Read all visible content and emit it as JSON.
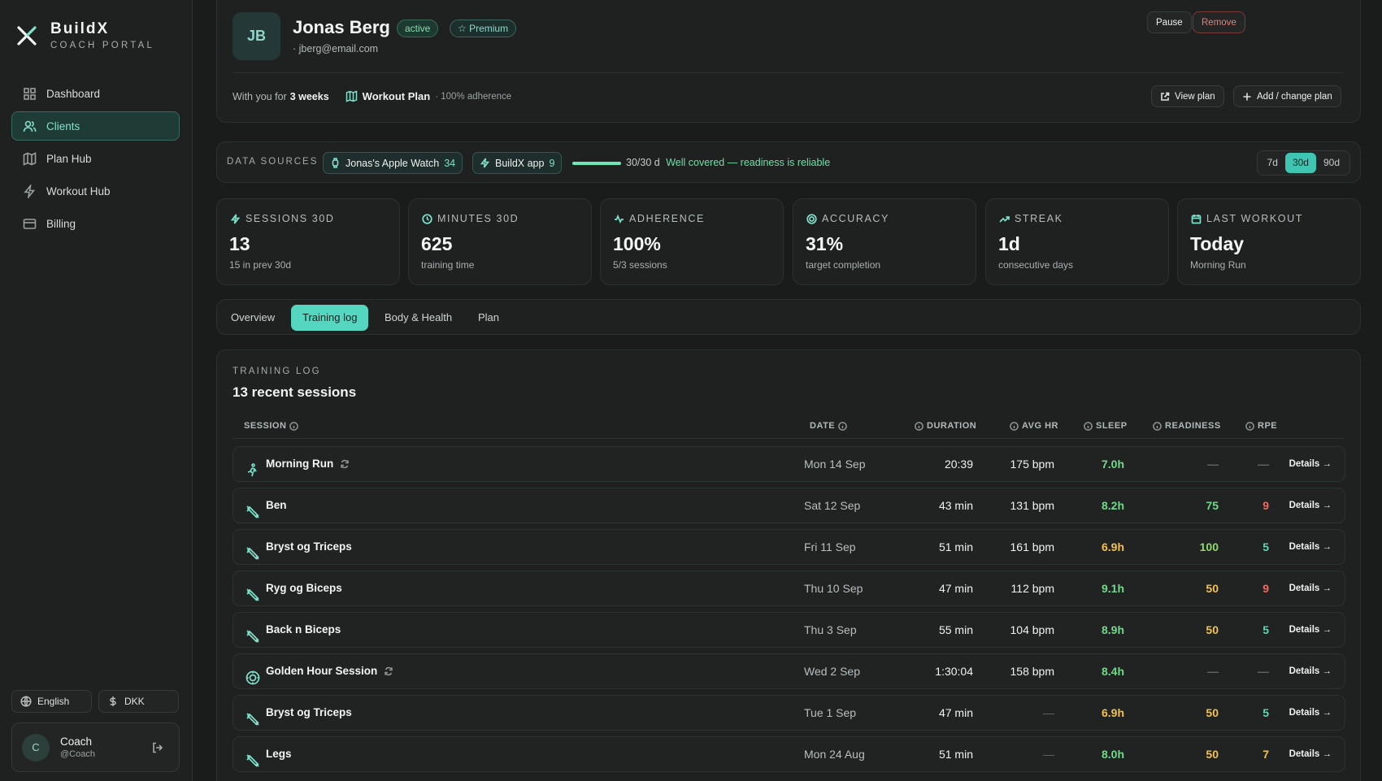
{
  "brand": {
    "name": "BuildX",
    "subtitle": "COACH PORTAL"
  },
  "nav": [
    {
      "label": "Dashboard",
      "icon": "grid-icon",
      "active": false
    },
    {
      "label": "Clients",
      "icon": "users-icon",
      "active": true
    },
    {
      "label": "Plan Hub",
      "icon": "map-icon",
      "active": false
    },
    {
      "label": "Workout Hub",
      "icon": "bolt-icon",
      "active": false
    },
    {
      "label": "Billing",
      "icon": "card-icon",
      "active": false
    }
  ],
  "settings": {
    "language": "English",
    "currency": "DKK"
  },
  "user": {
    "initial": "C",
    "name": "Coach",
    "handle": "@Coach"
  },
  "client": {
    "initials": "JB",
    "name": "Jonas Berg",
    "status": "active",
    "tier": "Premium",
    "email": "· jberg@email.com",
    "tenure_prefix": "With you for",
    "tenure_value": "3 weeks",
    "plan": "Workout Plan",
    "plan_adherence": "· 100% adherence",
    "actions": {
      "pause": "Pause",
      "remove": "Remove",
      "view_plan": "View plan",
      "change_plan": "Add / change plan"
    }
  },
  "sources": {
    "label": "DATA SOURCES",
    "items": [
      {
        "name": "Jonas's Apple Watch",
        "count": "34"
      },
      {
        "name": "BuildX app",
        "count": "9"
      }
    ],
    "coverage_fraction": 1.0,
    "coverage": "30/30 d",
    "coverage_status": "Well covered — readiness is reliable",
    "ranges": [
      "7d",
      "30d",
      "90d"
    ],
    "active_range": "30d"
  },
  "stats": [
    {
      "label": "SESSIONS 30D",
      "value": "13",
      "sub": "15 in prev 30d",
      "icon": "bolt-icon"
    },
    {
      "label": "MINUTES 30D",
      "value": "625",
      "sub": "training time",
      "icon": "clock-icon"
    },
    {
      "label": "ADHERENCE",
      "value": "100%",
      "sub": "5/3 sessions",
      "icon": "pulse-icon"
    },
    {
      "label": "ACCURACY",
      "value": "31%",
      "sub": "target completion",
      "icon": "target-icon"
    },
    {
      "label": "STREAK",
      "value": "1d",
      "sub": "consecutive days",
      "icon": "trend-icon"
    },
    {
      "label": "LAST WORKOUT",
      "value": "Today",
      "sub": "Morning Run",
      "icon": "calendar-icon"
    }
  ],
  "tabs": [
    "Overview",
    "Training log",
    "Body & Health",
    "Plan"
  ],
  "active_tab": "Training log",
  "log": {
    "label": "TRAINING LOG",
    "title": "13 recent sessions",
    "columns": {
      "session": "SESSION",
      "date": "DATE",
      "duration": "DURATION",
      "avg_hr": "AVG HR",
      "sleep": "SLEEP",
      "readiness": "READINESS",
      "rpe": "RPE"
    },
    "details_label": "Details →",
    "colors": {
      "green": "#73d98a",
      "yellow": "#f2c14e",
      "red": "#ef6a5f",
      "teal": "#5fd6b4",
      "lime": "#8fd96a"
    },
    "rows": [
      {
        "icon": "run-icon",
        "name": "Morning Run",
        "synced": true,
        "date": "Mon 14 Sep",
        "duration": "20:39",
        "avg_hr": "175 bpm",
        "sleep": "7.0h",
        "sleep_color": "#73d98a",
        "readiness": "—",
        "readiness_color": "#5f6464",
        "rpe": "—",
        "rpe_color": "#5f6464"
      },
      {
        "icon": "dumbbell-icon",
        "name": "Ben",
        "synced": false,
        "date": "Sat 12 Sep",
        "duration": "43 min",
        "avg_hr": "131 bpm",
        "sleep": "8.2h",
        "sleep_color": "#73d98a",
        "readiness": "75",
        "readiness_color": "#73d98a",
        "rpe": "9",
        "rpe_color": "#ef6a5f"
      },
      {
        "icon": "dumbbell-icon",
        "name": "Bryst og Triceps",
        "synced": false,
        "date": "Fri 11 Sep",
        "duration": "51 min",
        "avg_hr": "161 bpm",
        "sleep": "6.9h",
        "sleep_color": "#f2c14e",
        "readiness": "100",
        "readiness_color": "#8fd96a",
        "rpe": "5",
        "rpe_color": "#5fd6b4"
      },
      {
        "icon": "dumbbell-icon",
        "name": "Ryg og Biceps",
        "synced": false,
        "date": "Thu 10 Sep",
        "duration": "47 min",
        "avg_hr": "112 bpm",
        "sleep": "9.1h",
        "sleep_color": "#73d98a",
        "readiness": "50",
        "readiness_color": "#f2c14e",
        "rpe": "9",
        "rpe_color": "#ef6a5f"
      },
      {
        "icon": "dumbbell-icon",
        "name": "Back n Biceps",
        "synced": false,
        "date": "Thu 3 Sep",
        "duration": "55 min",
        "avg_hr": "104 bpm",
        "sleep": "8.9h",
        "sleep_color": "#73d98a",
        "readiness": "50",
        "readiness_color": "#f2c14e",
        "rpe": "5",
        "rpe_color": "#5fd6b4"
      },
      {
        "icon": "sun-icon",
        "name": "Golden Hour Session",
        "synced": true,
        "date": "Wed 2 Sep",
        "duration": "1:30:04",
        "avg_hr": "158 bpm",
        "sleep": "8.4h",
        "sleep_color": "#73d98a",
        "readiness": "—",
        "readiness_color": "#5f6464",
        "rpe": "—",
        "rpe_color": "#5f6464"
      },
      {
        "icon": "dumbbell-icon",
        "name": "Bryst og Triceps",
        "synced": false,
        "date": "Tue 1 Sep",
        "duration": "47 min",
        "avg_hr": "—",
        "sleep": "6.9h",
        "sleep_color": "#f2c14e",
        "readiness": "50",
        "readiness_color": "#f2c14e",
        "rpe": "5",
        "rpe_color": "#5fd6b4"
      },
      {
        "icon": "dumbbell-icon",
        "name": "Legs",
        "synced": false,
        "date": "Mon 24 Aug",
        "duration": "51 min",
        "avg_hr": "—",
        "sleep": "8.0h",
        "sleep_color": "#73d98a",
        "readiness": "50",
        "readiness_color": "#f2c14e",
        "rpe": "7",
        "rpe_color": "#f2c14e"
      }
    ]
  }
}
